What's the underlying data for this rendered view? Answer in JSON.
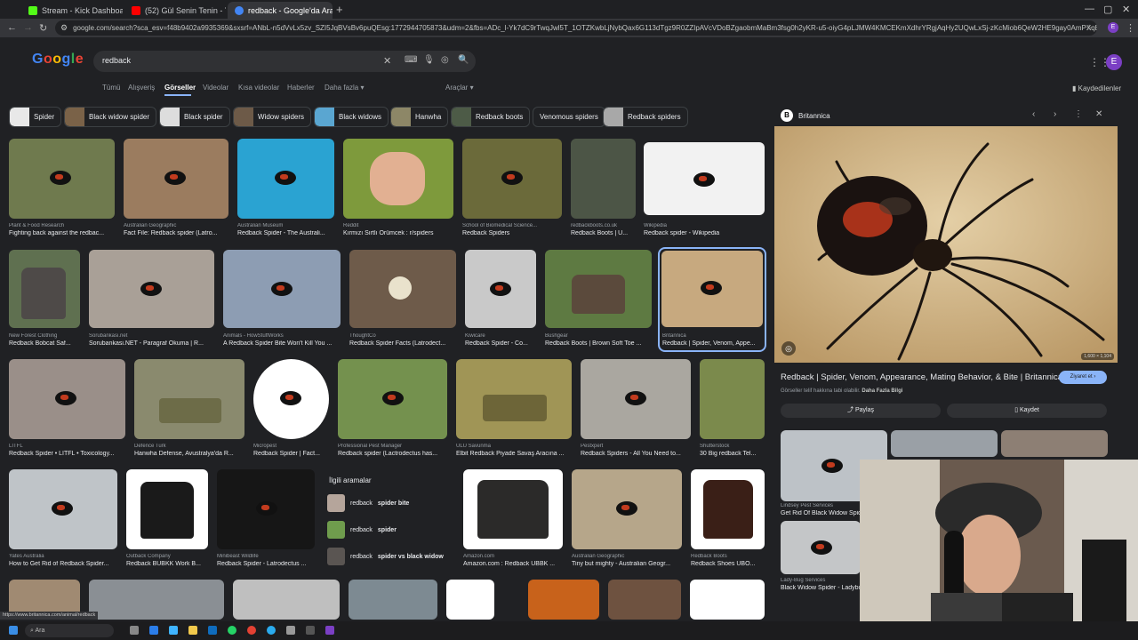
{
  "tabs": [
    {
      "title": "Stream - Kick Dashboard",
      "color": "#53fc18"
    },
    {
      "title": "(52) Gül Senin Tenin - YouTube",
      "color": "#ff0000"
    },
    {
      "title": "redback - Google'da Ara",
      "color": "#4285f4"
    }
  ],
  "address_bar": {
    "url": "google.com/search?sca_esv=f48b9402a9935369&sxsrf=ANbL-n5dVvLx5zv_SZI5JqBVsBv6puQEsg:1772944705873&udm=2&fbs=ADc_l-Yk7dC9rTwqJwl5T_1OTZKwbLjNybQax6G113dTgz9R0ZZIpAVcVDoBZgaobmMaBm3fsg0h2yKR-u5-oiyG4pLJMW4KMCEKmXdhrYRgjAqHy2UQwLxSj-zKcMiob6QeW2HE9gay0AmPXqBGcVsBb9MeHzzqoN340rtFMXQtNUrFJ88LhN..."
  },
  "google": {
    "logo_text": "Google",
    "search_query": "redback",
    "filters": [
      "Tümü",
      "Alışveriş",
      "Görseller",
      "Videolar",
      "Kısa videolar",
      "Haberler",
      "Daha fazla ▾"
    ],
    "active_filter": "Görseller",
    "tools": "Araçlar ▾",
    "saved": "Kaydedilenler",
    "avatar_letter": "E",
    "chips": [
      "Spider",
      "Black widow spider",
      "Black spider",
      "Widow spiders",
      "Black widows",
      "Hanwha",
      "Redback boots",
      "Venomous spiders",
      "Redback spiders"
    ]
  },
  "results": [
    {
      "src": "Plant & Food Research",
      "title": "Fighting back against the redbac..."
    },
    {
      "src": "Australian Geographic",
      "title": "Fact File: Redback spider (Latro..."
    },
    {
      "src": "Australian Museum",
      "title": "Redback Spider - The Australi..."
    },
    {
      "src": "Reddit",
      "title": "Kırmızı Sırtlı Örümcek : r/spiders"
    },
    {
      "src": "School of Biomedical Science...",
      "title": "Redback Spiders"
    },
    {
      "src": "redbackboots.co.uk",
      "title": "Redback Boots | U..."
    },
    {
      "src": "Wikipedia",
      "title": "Redback spider - Wikipedia"
    },
    {
      "src": "New Forest Clothing",
      "title": "Redback Bobcat Saf..."
    },
    {
      "src": "Sorubankasi.net",
      "title": "Sorubankasi.NET - Paragraf Okuma | R..."
    },
    {
      "src": "Animals - HowStuffWorks",
      "title": "A Redback Spider Bite Won't Kill You ..."
    },
    {
      "src": "ThoughtCo",
      "title": "Redback Spider Facts (Latrodect..."
    },
    {
      "src": "Kiwicare",
      "title": "Redback Spider - Co..."
    },
    {
      "src": "Bushgear",
      "title": "Redback Boots | Brown Soft Toe ..."
    },
    {
      "src": "Britannica",
      "title": "Redback | Spider, Venom, Appe..."
    },
    {
      "src": "LITFL",
      "title": "Redback Spider • LITFL • Toxicology..."
    },
    {
      "src": "Defence Turk",
      "title": "Hanwha Defense, Avustralya'da R..."
    },
    {
      "src": "Micropest",
      "title": "Redback Spider | Fact..."
    },
    {
      "src": "Professional Pest Manager",
      "title": "Redback spider (Lactrodectus has..."
    },
    {
      "src": "ULU Savunma",
      "title": "Elbit Redback Piyade Savaş Aracına ..."
    },
    {
      "src": "Pestxpert",
      "title": "Redback Spiders - All You Need to..."
    },
    {
      "src": "Shutterstock",
      "title": "30 Big redback Tel..."
    },
    {
      "src": "Yates Australia",
      "title": "How to Get Rid of Redback Spider..."
    },
    {
      "src": "Outback Company",
      "title": "Redback BUBKK Work B..."
    },
    {
      "src": "Minibeast Wildlife",
      "title": "Redback Spider - Latrodectus ..."
    },
    {
      "src": "Amazon.com",
      "title": "Amazon.com : Redback UBBK ..."
    },
    {
      "src": "Australian Geographic",
      "title": "Tiny but mighty - Australian Geogr..."
    },
    {
      "src": "Redback Boots",
      "title": "Redback Shoes UBO..."
    }
  ],
  "related": {
    "heading": "İlgili aramalar",
    "items": [
      {
        "prefix": "redback ",
        "bold": "spider bite"
      },
      {
        "prefix": "redback ",
        "bold": "spider"
      },
      {
        "prefix": "redback ",
        "bold": "spider vs black widow"
      }
    ]
  },
  "panel": {
    "source": "Britannica",
    "title": "Redback | Spider, Venom, Appearance, Mating Behavior, & Bite | Britannica",
    "visit": "Ziyaret et",
    "copyright_prefix": "Görseller telif hakkına tabi olabilir. ",
    "copyright_link": "Daha Fazla Bilgi",
    "share": "Paylaş",
    "save": "Kaydet",
    "size": "1,600 × 1,104",
    "more": [
      {
        "src": "Lindsey Pest Services",
        "title": "Get Rid Of Black Widow Spider..."
      },
      {
        "src": "Lady-Bug Services",
        "title": "Black Widow Spider - Ladybug..."
      }
    ]
  },
  "status_url": "https://www.britannica.com/animal/redback",
  "taskbar": {
    "search": "Ara"
  }
}
